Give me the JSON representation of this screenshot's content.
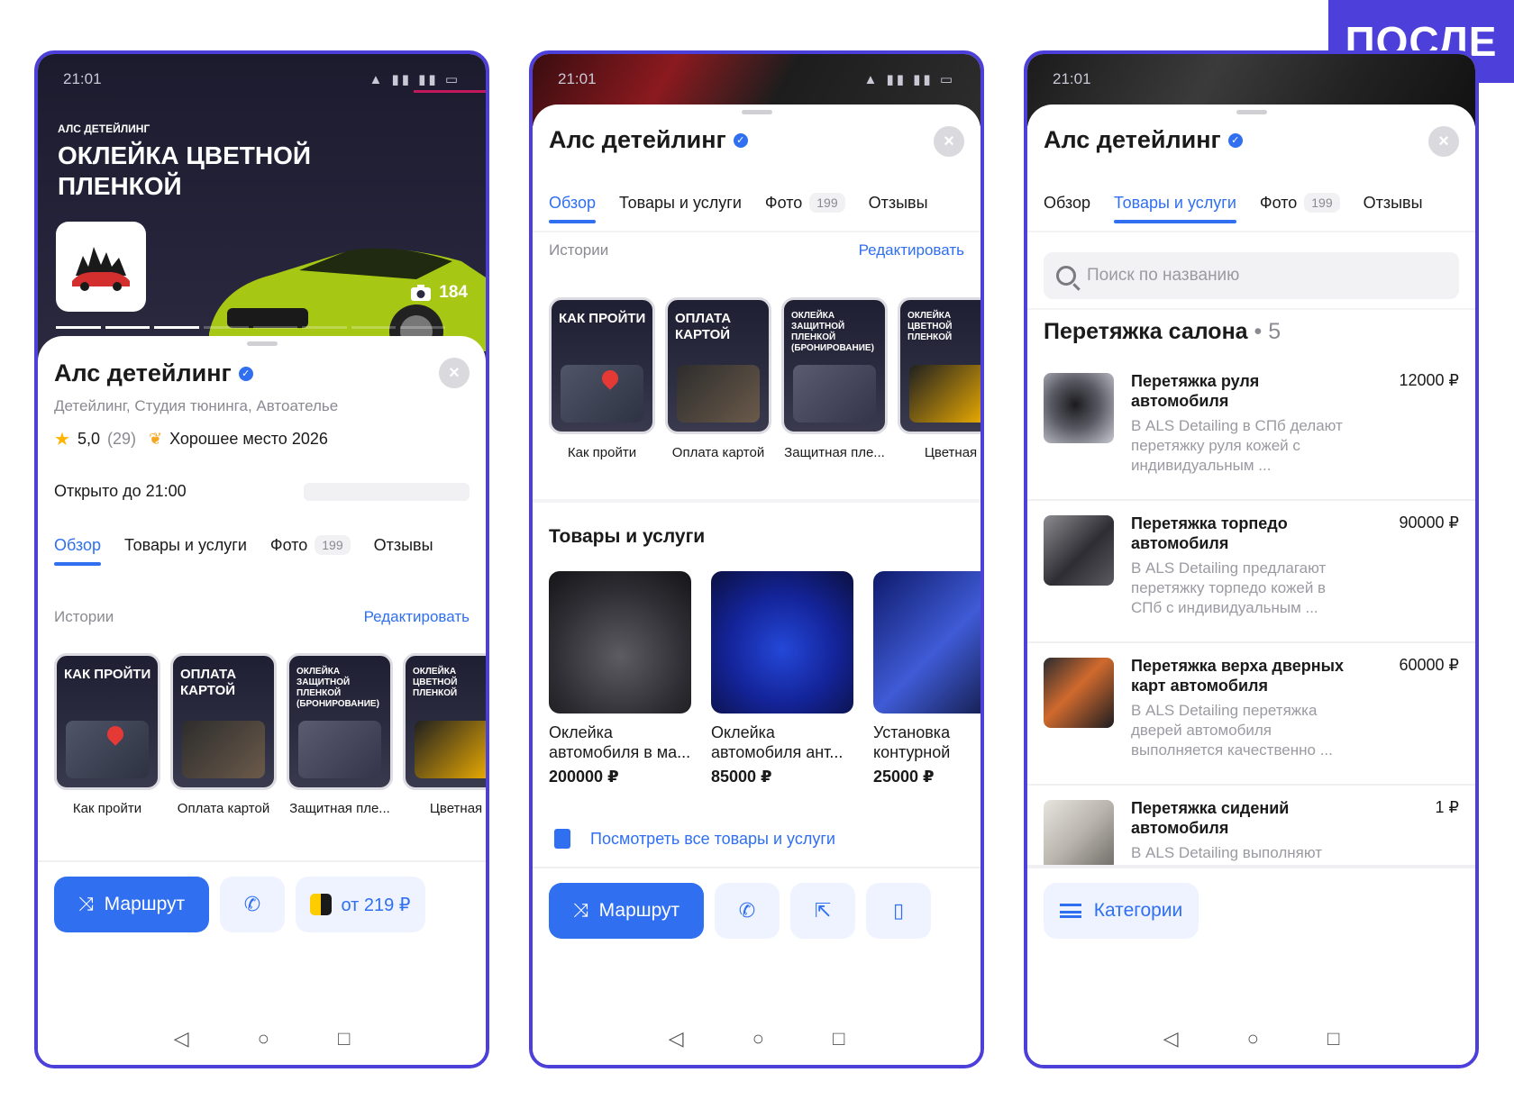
{
  "badge": "ПОСЛЕ",
  "status_time": "21:01",
  "business": {
    "name": "Алс детейлинг",
    "categories": "Детейлинг, Студия тюнинга, Автоателье",
    "rating": "5,0",
    "reviews_count": "(29)",
    "award": "Хорошее место 2026",
    "open_hours": "Открыто до 21:00"
  },
  "hero": {
    "brand": "АЛС ДЕТЕЙЛИНГ",
    "title": "ОКЛЕЙКА ЦВЕТНОЙ ПЛЕНКОЙ",
    "photo_count": "184"
  },
  "tabs": [
    {
      "label": "Обзор"
    },
    {
      "label": "Товары и услуги"
    },
    {
      "label": "Фото",
      "count": "199"
    },
    {
      "label": "Отзывы"
    }
  ],
  "stories_section": {
    "title": "Истории",
    "edit": "Редактировать"
  },
  "stories": [
    {
      "card": "КАК ПРОЙТИ",
      "label": "Как пройти"
    },
    {
      "card": "ОПЛАТА КАРТОЙ",
      "label": "Оплата картой"
    },
    {
      "card": "ОКЛЕЙКА ЗАЩИТНОЙ ПЛЕНКОЙ (БРОНИРОВАНИЕ)",
      "label": "Защитная пле..."
    },
    {
      "card": "ОКЛЕЙКА ЦВЕТНОЙ ПЛЕНКОЙ",
      "label": "Цветная"
    }
  ],
  "products_section": {
    "title": "Товары и услуги",
    "see_all": "Посмотреть все товары и услуги"
  },
  "products": [
    {
      "name": "Оклейка автомобиля в ма...",
      "price": "200000 ₽"
    },
    {
      "name": "Оклейка автомобиля ант...",
      "price": "85000 ₽"
    },
    {
      "name": "Установка контурной",
      "price": "25000 ₽"
    }
  ],
  "actions": {
    "route": "Маршрут",
    "taxi": "от 219 ₽",
    "categories": "Категории"
  },
  "search": {
    "placeholder": "Поиск по названию"
  },
  "group": {
    "title": "Перетяжка салона",
    "count": "• 5"
  },
  "items": [
    {
      "name": "Перетяжка руля автомобиля",
      "price": "12000 ₽",
      "desc": "В ALS Detailing в СПб делают перетяжку руля кожей с индивидуальным ..."
    },
    {
      "name": "Перетяжка торпедо автомобиля",
      "price": "90000 ₽",
      "desc": "В ALS Detailing предлагают перетяжку торпедо кожей в СПб с индивидуальным ..."
    },
    {
      "name": "Перетяжка верха дверных карт автомобиля",
      "price": "60000 ₽",
      "desc": "В ALS Detailing перетяжка дверей автомобиля выполняется качественно ..."
    },
    {
      "name": "Перетяжка сидений автомобиля",
      "price": "1 ₽",
      "desc": "В ALS Detailing выполняют перетяжку сидений автомобиля"
    }
  ],
  "colors": {
    "accent": "#2f6ff0",
    "frame": "#4d3fd9",
    "star": "#ffb400"
  }
}
